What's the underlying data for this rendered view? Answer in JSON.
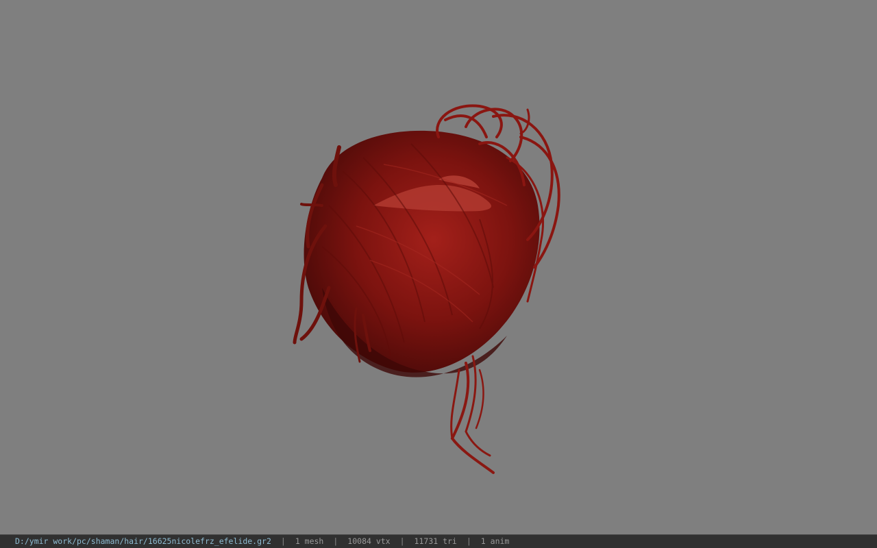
{
  "viewport": {
    "background_color": "#7f7f7f",
    "model_color": "#8a1410",
    "model_description_icon": "hair-mesh-model"
  },
  "status_bar": {
    "file_path": "D:/ymir work/pc/shaman/hair/16625nicolefrz_efelide.gr2",
    "separator": "|",
    "mesh_count": "1 mesh",
    "vertex_count": "10084 vtx",
    "triangle_count": "11731 tri",
    "anim_count": "1 anim"
  }
}
